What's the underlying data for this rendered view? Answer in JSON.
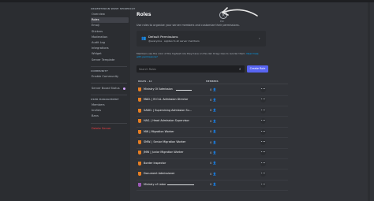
{
  "sidebar": {
    "server_category": "ARGENTINIAN WAVE SPIDERCAT",
    "items": [
      {
        "label": "Overview"
      },
      {
        "label": "Roles"
      },
      {
        "label": "Emoji"
      },
      {
        "label": "Stickers"
      },
      {
        "label": "Moderation"
      },
      {
        "label": "Audit Log"
      },
      {
        "label": "Integrations"
      },
      {
        "label": "Widget"
      },
      {
        "label": "Server Template"
      }
    ],
    "community_category": "COMMUNITY",
    "community_items": [
      {
        "label": "Enable Community"
      }
    ],
    "boost_item": {
      "label": "Server Boost Status"
    },
    "user_category": "USER MANAGEMENT",
    "user_items": [
      {
        "label": "Members"
      },
      {
        "label": "Invites"
      },
      {
        "label": "Bans"
      }
    ],
    "delete_label": "Delete Server"
  },
  "header": {
    "title": "Roles",
    "subtitle": "Use roles to organize your server members and customize their permissions.",
    "esc": "ESC"
  },
  "permissions_box": {
    "title": "Default Permissions",
    "subtitle": "@everyone · applies to all server members"
  },
  "info": {
    "text": "Members use the color of the highest role they have on this list. Drag roles to reorder them.",
    "link": "Need help with permissions?"
  },
  "search": {
    "placeholder": "Search Roles"
  },
  "create_button": "Create Role",
  "columns": {
    "roles": "ROLES – 12",
    "members": "MEMBERS"
  },
  "colors": {
    "accent": "#5865f2",
    "orange_role": "#e67e22",
    "purple_role": "#9b59b6"
  },
  "roles": [
    {
      "name": "Ministry Of Admission",
      "color": "#e67e22"
    },
    {
      "name": "MAD. | M.O.A. Admission Director",
      "color": "#e67e22"
    },
    {
      "name": "SADD. | Supervising Admission Su...",
      "color": "#e67e22"
    },
    {
      "name": "HAS. | Head Admission Supervisor",
      "color": "#e67e22"
    },
    {
      "name": "MW | Migration Worker",
      "color": "#e67e22"
    },
    {
      "name": "SMW. | Senior Migration Worker",
      "color": "#e67e22"
    },
    {
      "name": "JMW | Junior Migration Worker",
      "color": "#e67e22"
    },
    {
      "name": "Border Inspector",
      "color": "#e67e22"
    },
    {
      "name": "Document Admissioner",
      "color": "#e67e22"
    },
    {
      "name": "Ministry of Labor",
      "color": "#9b59b6"
    }
  ],
  "icons": {
    "member": "person-icon",
    "more": "more-icon",
    "close": "close-icon",
    "search": "search-icon"
  }
}
